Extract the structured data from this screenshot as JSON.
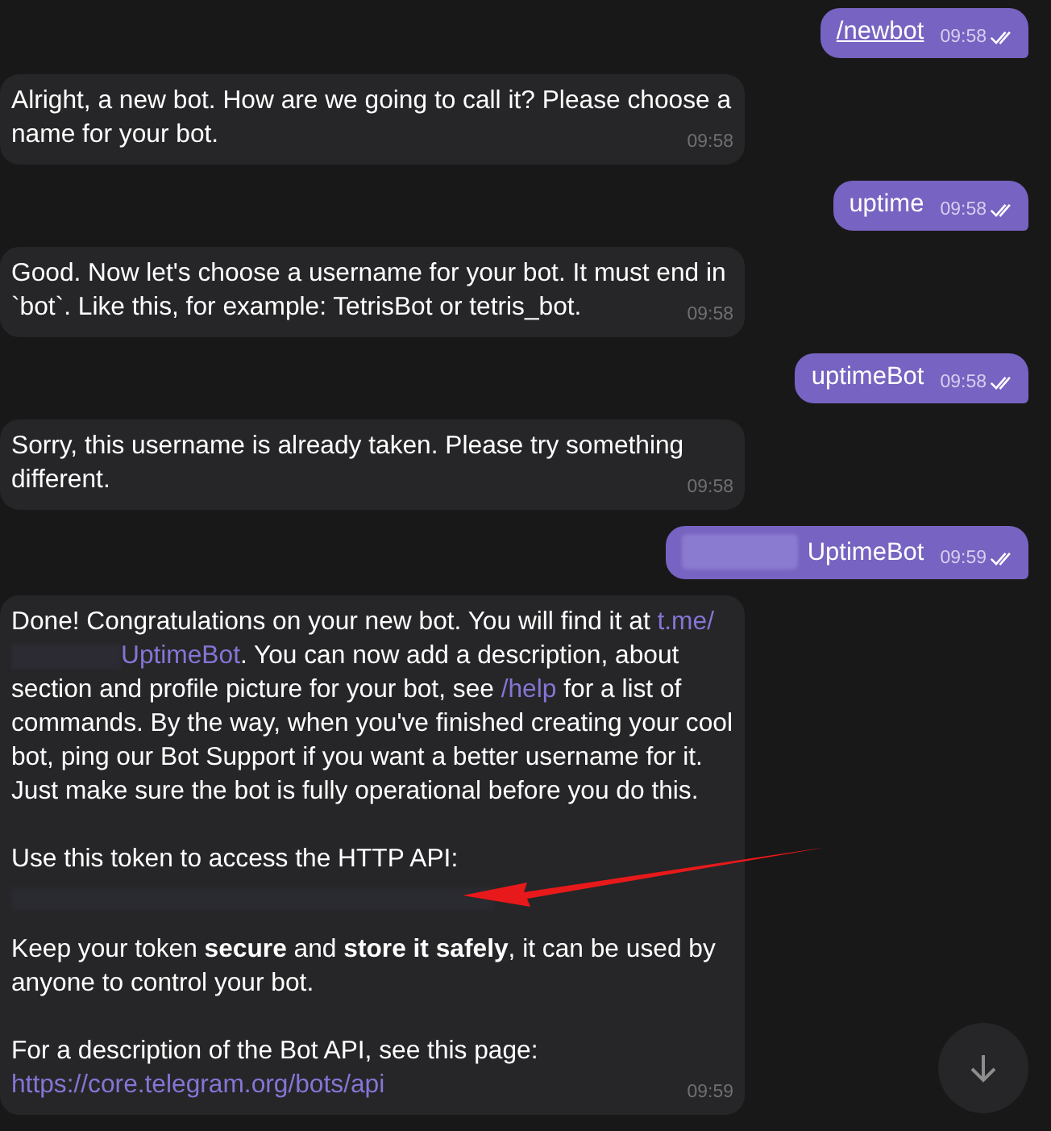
{
  "messages": [
    {
      "kind": "out",
      "read": true,
      "time": "09:58",
      "segments": [
        {
          "kind": "command",
          "text": "/newbot"
        }
      ]
    },
    {
      "kind": "in",
      "time": "09:58",
      "paragraphs": [
        [
          {
            "kind": "text",
            "text": "Alright, a new bot. How are we going to call it? Please choose a name for your bot."
          }
        ]
      ]
    },
    {
      "kind": "out",
      "read": true,
      "time": "09:58",
      "segments": [
        {
          "kind": "text",
          "text": "uptime"
        }
      ]
    },
    {
      "kind": "in",
      "time": "09:58",
      "paragraphs": [
        [
          {
            "kind": "text",
            "text": "Good. Now let's choose a username for your bot. It must end in `bot`. Like this, for example: TetrisBot or tetris_bot."
          }
        ]
      ]
    },
    {
      "kind": "out",
      "read": true,
      "time": "09:58",
      "segments": [
        {
          "kind": "text",
          "text": "uptimeBot"
        }
      ]
    },
    {
      "kind": "in",
      "time": "09:58",
      "paragraphs": [
        [
          {
            "kind": "text",
            "text": "Sorry, this username is already taken. Please try something different."
          }
        ]
      ]
    },
    {
      "kind": "out",
      "read": true,
      "time": "09:59",
      "segments": [
        {
          "kind": "redacted"
        },
        {
          "kind": "text",
          "text": "UptimeBot"
        }
      ]
    },
    {
      "kind": "in",
      "time": "09:59",
      "paragraphs": [
        [
          {
            "kind": "text",
            "text": "Done! Congratulations on your new bot. You will find it at "
          },
          {
            "kind": "link",
            "text": "t.me/"
          },
          {
            "kind": "redacted"
          },
          {
            "kind": "link",
            "text": "UptimeBot"
          },
          {
            "kind": "text",
            "text": ". You can now add a description, about section and profile picture for your bot, see "
          },
          {
            "kind": "link",
            "text": "/help"
          },
          {
            "kind": "text",
            "text": " for a list of commands. By the way, when you've finished creating your cool bot, ping our Bot Support if you want a better username for it. Just make sure the bot is fully operational before you do this."
          }
        ],
        [
          {
            "kind": "text",
            "text": "Use this token to access the HTTP API:"
          }
        ],
        [
          {
            "kind": "redacted-line"
          }
        ],
        [
          {
            "kind": "text",
            "text": "Keep your token **secure** and **store it safely**, it can be used by anyone to control your bot."
          }
        ],
        [
          {
            "kind": "text",
            "text": "For a description of the Bot API, see this page: "
          },
          {
            "kind": "link",
            "text": "https://core.telegram.org/bots/api"
          }
        ]
      ]
    }
  ],
  "annotation": {
    "kind": "arrow"
  },
  "scroll_button": {
    "kind": "down"
  }
}
